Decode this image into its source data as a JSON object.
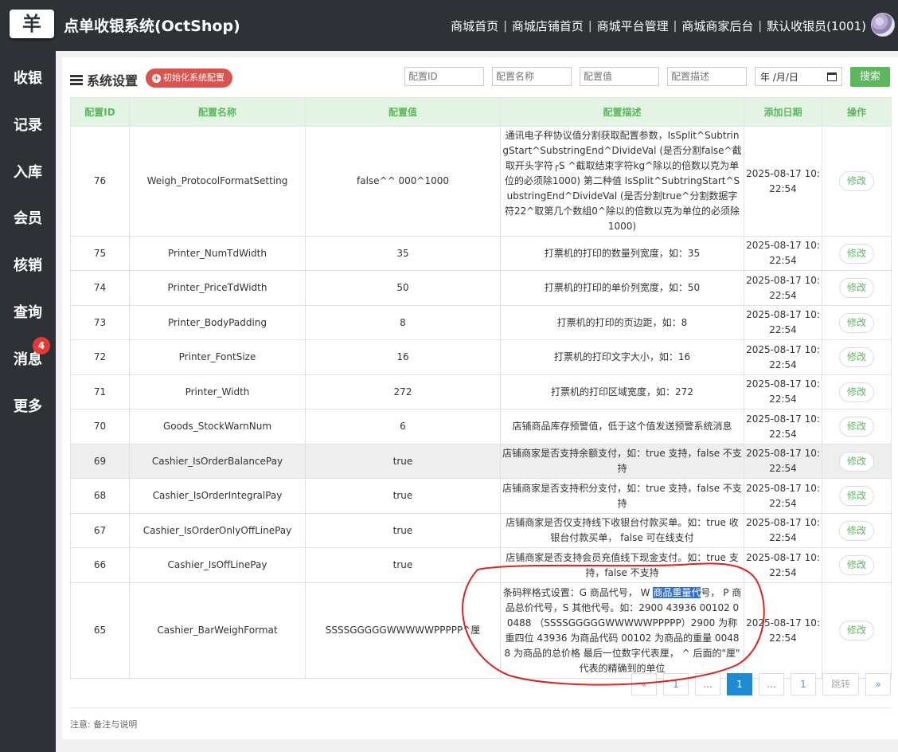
{
  "header": {
    "logo_glyph": "羊",
    "title": "点单收银系统(OctShop)",
    "nav": [
      "商城首页",
      "商城店铺首页",
      "商城平台管理",
      "商城商家后台",
      "默认收银员(1001)"
    ]
  },
  "sidebar": {
    "items": [
      {
        "label": "收银"
      },
      {
        "label": "记录"
      },
      {
        "label": "入库"
      },
      {
        "label": "会员"
      },
      {
        "label": "核销"
      },
      {
        "label": "查询"
      },
      {
        "label": "消息",
        "badge": "4"
      },
      {
        "label": "更多"
      }
    ]
  },
  "panel": {
    "title": "系统设置",
    "init_button": "初始化系统配置",
    "filters": {
      "config_id_placeholder": "配置ID",
      "config_name_placeholder": "配置名称",
      "config_value_placeholder": "配置值",
      "config_desc_placeholder": "配置描述",
      "date_value": "年 /月/日"
    },
    "search_button": "搜索"
  },
  "table": {
    "headers": [
      "配置ID",
      "配置名称",
      "配置值",
      "配置描述",
      "添加日期",
      "操作"
    ],
    "edit_label": "修改",
    "rows": [
      {
        "id": "76",
        "name": "Weigh_ProtocolFormatSetting",
        "value": "false^^ 000^1000",
        "desc": "通讯电子秤协议值分割获取配置参数，IsSplit^SubtringStart^SubstringEnd^DivideVal (是否分割false^截取开头字符┌S ^截取结束字符kg^除以的倍数以克为单位的必须除1000) 第二种值 IsSplit^SubtringStart^SubstringEnd^DivideVal (是否分割true^分割数据字符22^取第几个数组0^除以的倍数以克为单位的必须除1000)",
        "date": "2025-08-17 10:22:54"
      },
      {
        "id": "75",
        "name": "Printer_NumTdWidth",
        "value": "35",
        "desc": "打票机的打印的数量列宽度，如：35",
        "date": "2025-08-17 10:22:54"
      },
      {
        "id": "74",
        "name": "Printer_PriceTdWidth",
        "value": "50",
        "desc": "打票机的打印的单价列宽度，如：50",
        "date": "2025-08-17 10:22:54"
      },
      {
        "id": "73",
        "name": "Printer_BodyPadding",
        "value": "8",
        "desc": "打票机的打印的页边距，如：8",
        "date": "2025-08-17 10:22:54"
      },
      {
        "id": "72",
        "name": "Printer_FontSize",
        "value": "16",
        "desc": "打票机的打印文字大小，如：16",
        "date": "2025-08-17 10:22:54"
      },
      {
        "id": "71",
        "name": "Printer_Width",
        "value": "272",
        "desc": "打票机的打印区域宽度，如：272",
        "date": "2025-08-17 10:22:54"
      },
      {
        "id": "70",
        "name": "Goods_StockWarnNum",
        "value": "6",
        "desc": "店铺商品库存预警值，低于这个值发送预警系统消息",
        "date": "2025-08-17 10:22:54"
      },
      {
        "id": "69",
        "name": "Cashier_IsOrderBalancePay",
        "value": "true",
        "desc": "店铺商家是否支持余额支付，如：true 支持，false 不支持",
        "date": "2025-08-17 10:22:54"
      },
      {
        "id": "68",
        "name": "Cashier_IsOrderIntegralPay",
        "value": "true",
        "desc": "店铺商家是否支持积分支付，如：true 支持，false 不支持",
        "date": "2025-08-17 10:22:54"
      },
      {
        "id": "67",
        "name": "Cashier_IsOrderOnlyOffLinePay",
        "value": "true",
        "desc": "店铺商家是否仅支持线下收银台付款买单。如：true 收银台付款买单， false 可在线支付",
        "date": "2025-08-17 10:22:54"
      },
      {
        "id": "66",
        "name": "Cashier_IsOffLinePay",
        "value": "true",
        "desc": "店铺商家是否支持会员充值线下现金支付。如：true 支持，false 不支持",
        "date": "2025-08-17 10:22:54"
      },
      {
        "id": "65",
        "name": "Cashier_BarWeighFormat",
        "value": "SSSSGGGGGWWWWWPPPPP^厘",
        "desc_pre": "条码秤格式设置：G 商品代号， W ",
        "desc_sel": "商品重量代",
        "desc_post": "号， P 商品总价代号，S 其他代号。如：2900 43936 00102 00488 （SSSSGGGGGWWWWWPPPPP）2900 为称重四位 43936 为商品代码 00102 为商品的重量 00488 为商品的总价格 最后一位数字代表厘， ^ 后面的\"厘\" 代表的精确到的单位",
        "date": "2025-08-17 10:22:54"
      }
    ]
  },
  "pagination": {
    "prev": "«",
    "first": "1",
    "ellipsis_left": "…",
    "current": "1",
    "ellipsis_right": "…",
    "last": "1",
    "jump_placeholder": "跳转",
    "next": "»"
  },
  "footer": {
    "note": "注意: 备注与说明"
  }
}
